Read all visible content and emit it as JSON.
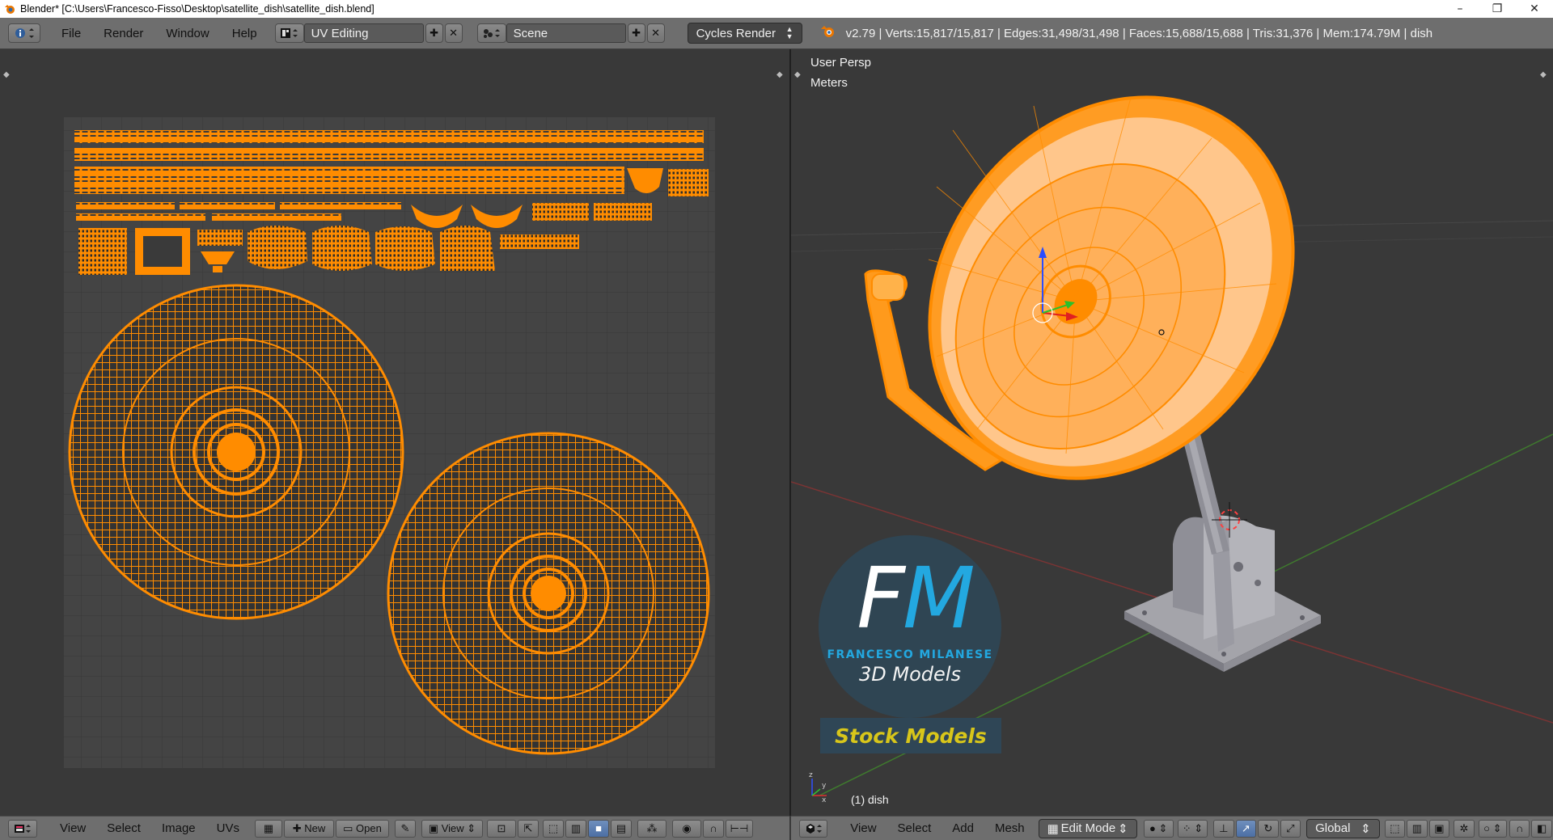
{
  "window": {
    "title": "Blender* [C:\\Users\\Francesco-Fisso\\Desktop\\satellite_dish\\satellite_dish.blend]",
    "minimize": "–",
    "maximize": "❐",
    "close": "✕"
  },
  "infobar": {
    "menus": [
      "File",
      "Render",
      "Window",
      "Help"
    ],
    "layout": "UV Editing",
    "scene": "Scene",
    "engine": "Cycles Render",
    "stats": "v2.79 | Verts:15,817/15,817 | Edges:31,498/31,498 | Faces:15,688/15,688 | Tris:31,376 | Mem:174.79M | dish"
  },
  "uv_editor": {
    "menus": [
      "View",
      "Select",
      "Image",
      "UVs"
    ],
    "new_label": "New",
    "open_label": "Open",
    "view_label": "View"
  },
  "viewport": {
    "view_name": "User Persp",
    "units": "Meters",
    "object_label": "(1) dish",
    "menus": [
      "View",
      "Select",
      "Add",
      "Mesh"
    ],
    "mode": "Edit Mode",
    "orientation": "Global"
  },
  "watermark": {
    "initial_f": "F",
    "initial_m": "M",
    "name": "FRANCESCO MILANESE",
    "subtitle": "3D Models",
    "badge": "Stock Models"
  },
  "colors": {
    "mesh_orange": "#ff8c00",
    "header_grey": "#6e6e6e",
    "background": "#393939",
    "logo_blue": "#23a8e0",
    "badge_yellow": "#d8c61a"
  }
}
